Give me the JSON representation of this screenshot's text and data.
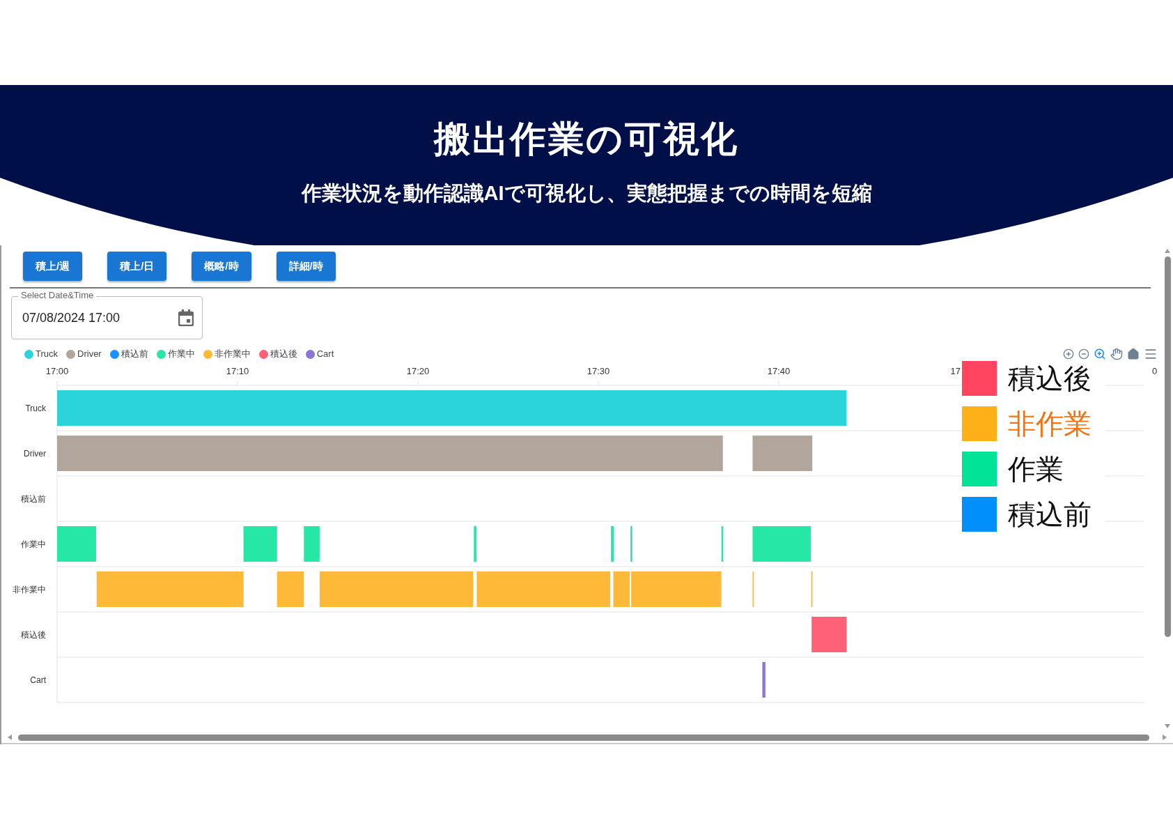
{
  "header": {
    "title": "搬出作業の可視化",
    "subtitle": "作業状況を動作認識AIで可視化し、実態把握までの時間を短縮"
  },
  "buttons": [
    {
      "label": "積上/週"
    },
    {
      "label": "積上/日"
    },
    {
      "label": "概略/時"
    },
    {
      "label": "詳細/時"
    }
  ],
  "date_field": {
    "label": "Select Date&Time",
    "value": "07/08/2024 17:00"
  },
  "legend": {
    "items": [
      {
        "label": "Truck",
        "color": "#2ad4d8"
      },
      {
        "label": "Driver",
        "color": "#b2a59b"
      },
      {
        "label": "積込前",
        "color": "#1e90ff"
      },
      {
        "label": "作業中",
        "color": "#26e7a6"
      },
      {
        "label": "非作業中",
        "color": "#feb938"
      },
      {
        "label": "積込後",
        "color": "#ff6178"
      },
      {
        "label": "Cart",
        "color": "#8b75d7"
      }
    ]
  },
  "timeline": {
    "ticks": [
      "17:00",
      "17:10",
      "17:20",
      "17:30",
      "17:40",
      "17",
      "0"
    ],
    "rows": [
      {
        "label": "Truck",
        "color": "#2ad4d8"
      },
      {
        "label": "Driver",
        "color": "#b2a59b"
      },
      {
        "label": "積込前"
      },
      {
        "label": "作業中",
        "color": "#26e7a6"
      },
      {
        "label": "非作業中",
        "color": "#feb938"
      },
      {
        "label": "積込後",
        "color": "#ff6178"
      },
      {
        "label": "Cart",
        "color": "#8b75d7"
      }
    ]
  },
  "overlay_legend": {
    "items": [
      {
        "label": "積込後",
        "color": "#ff4560",
        "highlighted": false
      },
      {
        "label": "非作業",
        "color": "#feb019",
        "highlighted": true
      },
      {
        "label": "作業",
        "color": "#00e396",
        "highlighted": false
      },
      {
        "label": "積込前",
        "color": "#008ffb",
        "highlighted": false
      }
    ]
  }
}
